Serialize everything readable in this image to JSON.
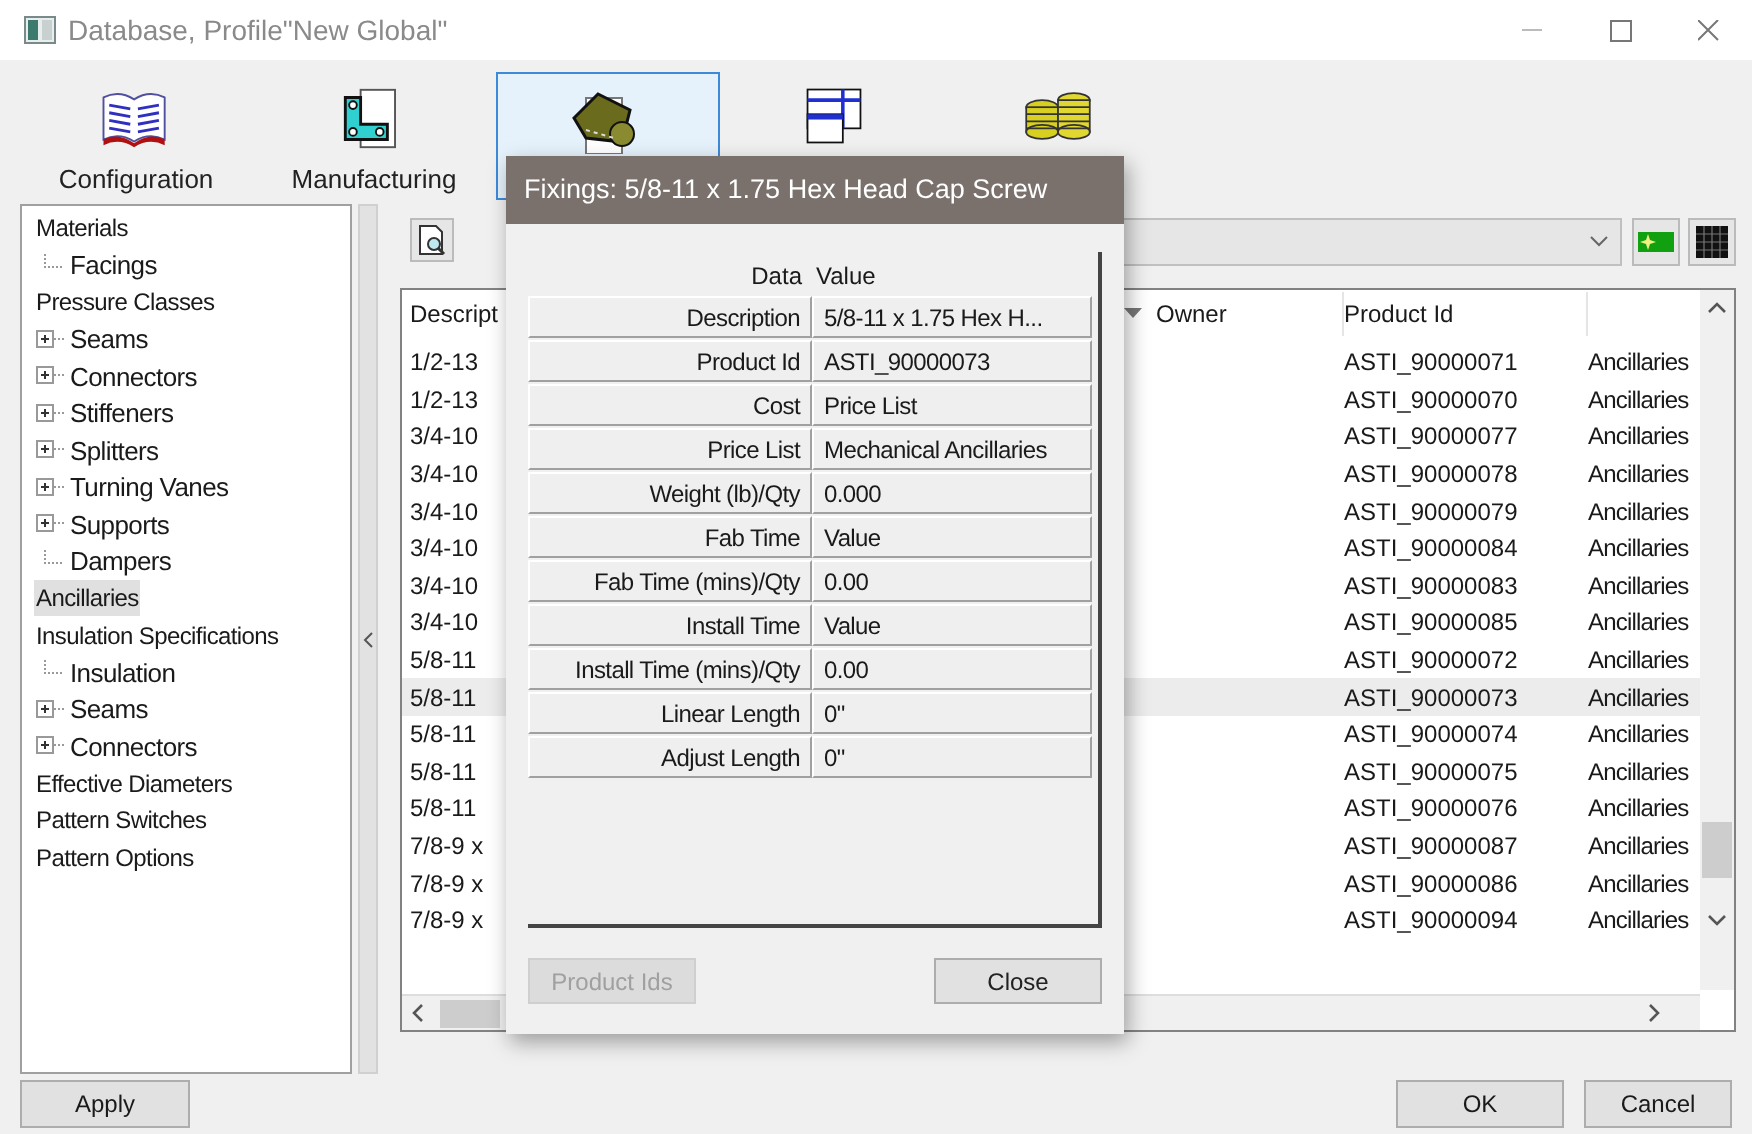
{
  "window": {
    "title": "Database, Profile\"New Global\""
  },
  "toolbar": [
    {
      "kind": "book",
      "label": "Configuration",
      "selected": false
    },
    {
      "kind": "bracket",
      "label": "Manufacturing",
      "selected": false
    },
    {
      "kind": "polygon",
      "selected": true
    },
    {
      "kind": "layout",
      "selected": false
    },
    {
      "kind": "coins",
      "selected": false
    }
  ],
  "tree": [
    {
      "label": "Materials",
      "selected": false,
      "children": [
        {
          "label": "Facings",
          "selected": false
        }
      ]
    },
    {
      "label": "Pressure Classes",
      "selected": false,
      "children": [
        {
          "label": "Seams",
          "selected": false,
          "expanded": false
        },
        {
          "label": "Connectors",
          "selected": false,
          "expanded": false
        },
        {
          "label": "Stiffeners",
          "selected": false,
          "expanded": false
        },
        {
          "label": "Splitters",
          "selected": false,
          "expanded": false
        },
        {
          "label": "Turning Vanes",
          "selected": false,
          "expanded": false
        },
        {
          "label": "Supports",
          "selected": false,
          "expanded": false
        },
        {
          "label": "Dampers",
          "selected": false
        }
      ]
    },
    {
      "label": "Ancillaries",
      "selected": true
    },
    {
      "label": "Insulation Specifications",
      "selected": false,
      "children": [
        {
          "label": "Insulation",
          "selected": false
        },
        {
          "label": "Seams",
          "selected": false,
          "expanded": false
        },
        {
          "label": "Connectors",
          "selected": false,
          "expanded": false
        }
      ]
    },
    {
      "label": "Effective Diameters",
      "selected": false
    },
    {
      "label": "Pattern Switches",
      "selected": false
    },
    {
      "label": "Pattern Options",
      "selected": false
    }
  ],
  "list": {
    "columns": [
      "Descript",
      "Owner",
      "Product Id"
    ],
    "rows": [
      {
        "description": "1/2-13",
        "product_id": "ASTI_90000071",
        "column_4": "Ancillaries",
        "selected": false
      },
      {
        "description": "1/2-13",
        "product_id": "ASTI_90000070",
        "column_4": "Ancillaries",
        "selected": false
      },
      {
        "description": "3/4-10",
        "product_id": "ASTI_90000077",
        "column_4": "Ancillaries",
        "selected": false
      },
      {
        "description": "3/4-10",
        "product_id": "ASTI_90000078",
        "column_4": "Ancillaries",
        "selected": false
      },
      {
        "description": "3/4-10",
        "product_id": "ASTI_90000079",
        "column_4": "Ancillaries",
        "selected": false
      },
      {
        "description": "3/4-10",
        "product_id": "ASTI_90000084",
        "column_4": "Ancillaries",
        "selected": false
      },
      {
        "description": "3/4-10",
        "product_id": "ASTI_90000083",
        "column_4": "Ancillaries",
        "selected": false
      },
      {
        "description": "3/4-10",
        "product_id": "ASTI_90000085",
        "column_4": "Ancillaries",
        "selected": false
      },
      {
        "description": "5/8-11",
        "product_id": "ASTI_90000072",
        "column_4": "Ancillaries",
        "selected": false
      },
      {
        "description": "5/8-11",
        "product_id": "ASTI_90000073",
        "column_4": "Ancillaries",
        "selected": true
      },
      {
        "description": "5/8-11",
        "product_id": "ASTI_90000074",
        "column_4": "Ancillaries",
        "selected": false
      },
      {
        "description": "5/8-11",
        "product_id": "ASTI_90000075",
        "column_4": "Ancillaries",
        "selected": false
      },
      {
        "description": "5/8-11",
        "product_id": "ASTI_90000076",
        "column_4": "Ancillaries",
        "selected": false
      },
      {
        "description": "7/8-9 x",
        "product_id": "ASTI_90000087",
        "column_4": "Ancillaries",
        "selected": false
      },
      {
        "description": "7/8-9 x",
        "product_id": "ASTI_90000086",
        "column_4": "Ancillaries",
        "selected": false
      },
      {
        "description": "7/8-9 x",
        "product_id": "ASTI_90000094",
        "column_4": "Ancillaries",
        "selected": false
      }
    ]
  },
  "dialog": {
    "title": "Fixings:  5/8-11 x 1.75 Hex Head Cap Screw",
    "header": [
      "Data",
      "Value"
    ],
    "rows": [
      {
        "label": "Description",
        "value": "5/8-11 x 1.75 Hex H..."
      },
      {
        "label": "Product Id",
        "value": "ASTI_90000073"
      },
      {
        "label": "Cost",
        "value": "Price List"
      },
      {
        "label": "Price List",
        "value": "Mechanical Ancillaries"
      },
      {
        "label": "Weight (lb)/Qty",
        "value": "0.000"
      },
      {
        "label": "Fab Time",
        "value": "Value"
      },
      {
        "label": "Fab Time (mins)/Qty",
        "value": "0.00"
      },
      {
        "label": "Install Time",
        "value": "Value"
      },
      {
        "label": "Install Time (mins)/Qty",
        "value": "0.00"
      },
      {
        "label": "Linear Length",
        "value": "0\""
      },
      {
        "label": "Adjust Length",
        "value": "0\""
      }
    ],
    "buttons": [
      {
        "label": "Product Ids",
        "disabled": true
      },
      {
        "label": "Close",
        "disabled": false
      }
    ]
  },
  "buttons": {
    "apply": "Apply",
    "ok": "OK",
    "cancel": "Cancel"
  }
}
